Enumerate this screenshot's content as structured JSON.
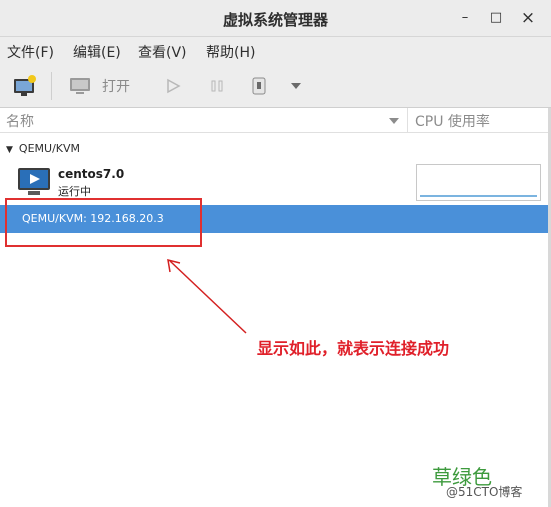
{
  "window": {
    "title": "虚拟系统管理器",
    "minimize": "–",
    "maximize": "□",
    "close": "×"
  },
  "menu": [
    "文件(F)",
    "编辑(E)",
    "查看(V)",
    "帮助(H)"
  ],
  "toolbar": {
    "open_label": "打开"
  },
  "columns": {
    "name": "名称",
    "cpu": "CPU 使用率"
  },
  "group": {
    "label": "QEMU/KVM"
  },
  "vm": {
    "name": "centos7.0",
    "status": "运行中"
  },
  "connection": {
    "label": "QEMU/KVM: 192.168.20.3"
  },
  "annotation": {
    "text": "显示如此，就表示连接成功"
  },
  "watermark": {
    "line1": "草绿色",
    "line2": "@51CTO博客"
  },
  "colors": {
    "selection": "#4a90d9",
    "annotation": "#e0202a",
    "watermark": "#3d9a3d"
  }
}
